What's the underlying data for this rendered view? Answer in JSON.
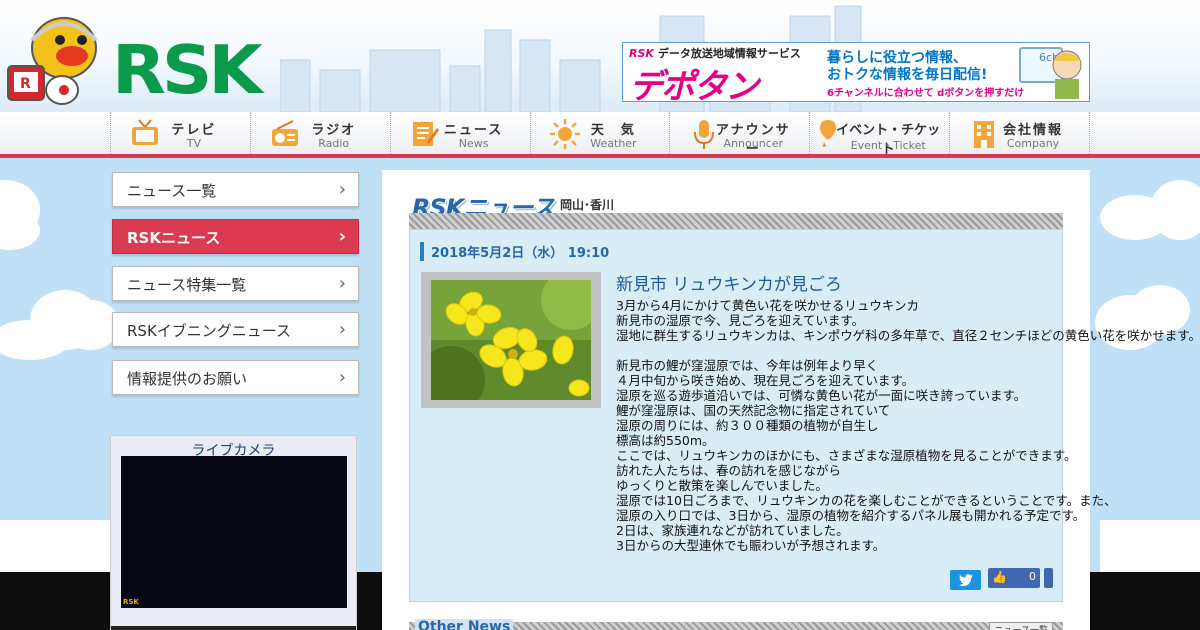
{
  "header": {
    "logo": "RSK",
    "banner": {
      "top_line_brand": "RSK",
      "top_line": "データ放送地域情報サービス",
      "service_name": "デポタン",
      "line1": "暮らしに役立つ情報、",
      "line2": "おトクな情報を毎日配信!",
      "line3": "6チャンネルに合わせて dボタンを押すだけ",
      "channel": "6ch"
    }
  },
  "nav": {
    "items": [
      {
        "jp": "テレビ",
        "en": "TV",
        "icon": "tv-icon"
      },
      {
        "jp": "ラジオ",
        "en": "Radio",
        "icon": "radio-icon"
      },
      {
        "jp": "ニュース",
        "en": "News",
        "icon": "news-icon"
      },
      {
        "jp": "天　気",
        "en": "Weather",
        "icon": "sun-icon"
      },
      {
        "jp": "アナウンサー",
        "en": "Announcer",
        "icon": "microphone-icon"
      },
      {
        "jp": "イベント・チケット",
        "en": "Event・Ticket",
        "icon": "pin-icon"
      },
      {
        "jp": "会社情報",
        "en": "Company",
        "icon": "building-icon"
      }
    ]
  },
  "sidebar": {
    "items": [
      {
        "label": "ニュース一覧"
      },
      {
        "label": "RSKニュース"
      },
      {
        "label": "ニュース特集一覧"
      },
      {
        "label": "RSKイブニングニュース"
      },
      {
        "label": "情報提供のお願い"
      }
    ],
    "livecam_title": "ライブカメラ",
    "livecam_watermark": "RSK"
  },
  "main": {
    "news_logo": "RSKニュース",
    "region": "岡山･香川",
    "article": {
      "date": "2018年5月2日（水） 19:10",
      "headline": "新見市 リュウキンカが見ごろ",
      "lines": [
        "3月から4月にかけて黄色い花を咲かせるリュウキンカ",
        "新見市の湿原で今、見ごろを迎えています。",
        "湿地に群生するリュウキンカは、キンポウゲ科の多年草で、直径２センチほどの黄色い花を咲かせます。",
        "",
        "新見市の鯉が窪湿原では、今年は例年より早く",
        "４月中旬から咲き始め、現在見ごろを迎えています。",
        "湿原を巡る遊歩道沿いでは、可憐な黄色い花が一面に咲き誇っています。",
        "鯉が窪湿原は、国の天然記念物に指定されていて",
        "湿原の周りには、約３００種類の植物が自生し",
        "標高は約550m。",
        "ここでは、リュウキンカのほかにも、さまざまな湿原植物を見ることができます。",
        "訪れた人たちは、春の訪れを感じながら",
        "ゆっくりと散策を楽しんでいました。",
        "湿原では10日ごろまで、リュウキンカの花を楽しむことができるということです。また、",
        "湿原の入り口では、3日から、湿原の植物を紹介するパネル展も開かれる予定です。",
        "2日は、家族連れなどが訪れていました。",
        "3日からの大型連休でも賑わいが予想されます。"
      ],
      "like_count": "0",
      "tweet_icon": "twitter-bird-icon",
      "like_icon": "thumbs-up-icon"
    },
    "other_news_label": "Other News",
    "other_news_button": "ニュース一覧"
  },
  "colors": {
    "brand_green": "#0b9a4a",
    "accent_red": "#dc3a50",
    "link_blue": "#1e5aa0"
  }
}
